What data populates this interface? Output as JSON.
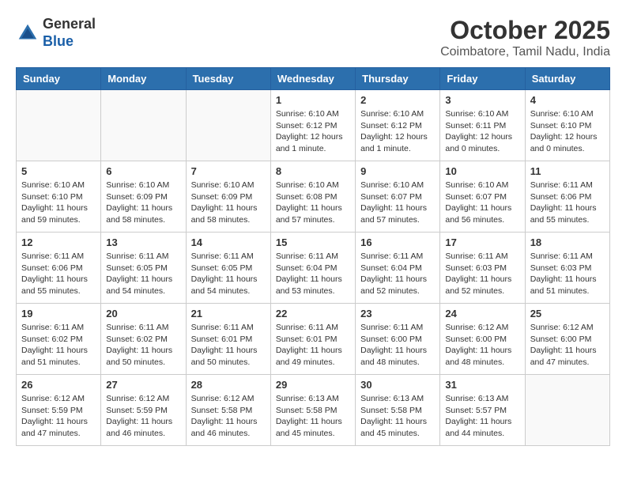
{
  "header": {
    "logo_line1": "General",
    "logo_line2": "Blue",
    "month_title": "October 2025",
    "location": "Coimbatore, Tamil Nadu, India"
  },
  "days_of_week": [
    "Sunday",
    "Monday",
    "Tuesday",
    "Wednesday",
    "Thursday",
    "Friday",
    "Saturday"
  ],
  "weeks": [
    [
      {
        "day": "",
        "info": ""
      },
      {
        "day": "",
        "info": ""
      },
      {
        "day": "",
        "info": ""
      },
      {
        "day": "1",
        "info": "Sunrise: 6:10 AM\nSunset: 6:12 PM\nDaylight: 12 hours\nand 1 minute."
      },
      {
        "day": "2",
        "info": "Sunrise: 6:10 AM\nSunset: 6:12 PM\nDaylight: 12 hours\nand 1 minute."
      },
      {
        "day": "3",
        "info": "Sunrise: 6:10 AM\nSunset: 6:11 PM\nDaylight: 12 hours\nand 0 minutes."
      },
      {
        "day": "4",
        "info": "Sunrise: 6:10 AM\nSunset: 6:10 PM\nDaylight: 12 hours\nand 0 minutes."
      }
    ],
    [
      {
        "day": "5",
        "info": "Sunrise: 6:10 AM\nSunset: 6:10 PM\nDaylight: 11 hours\nand 59 minutes."
      },
      {
        "day": "6",
        "info": "Sunrise: 6:10 AM\nSunset: 6:09 PM\nDaylight: 11 hours\nand 58 minutes."
      },
      {
        "day": "7",
        "info": "Sunrise: 6:10 AM\nSunset: 6:09 PM\nDaylight: 11 hours\nand 58 minutes."
      },
      {
        "day": "8",
        "info": "Sunrise: 6:10 AM\nSunset: 6:08 PM\nDaylight: 11 hours\nand 57 minutes."
      },
      {
        "day": "9",
        "info": "Sunrise: 6:10 AM\nSunset: 6:07 PM\nDaylight: 11 hours\nand 57 minutes."
      },
      {
        "day": "10",
        "info": "Sunrise: 6:10 AM\nSunset: 6:07 PM\nDaylight: 11 hours\nand 56 minutes."
      },
      {
        "day": "11",
        "info": "Sunrise: 6:11 AM\nSunset: 6:06 PM\nDaylight: 11 hours\nand 55 minutes."
      }
    ],
    [
      {
        "day": "12",
        "info": "Sunrise: 6:11 AM\nSunset: 6:06 PM\nDaylight: 11 hours\nand 55 minutes."
      },
      {
        "day": "13",
        "info": "Sunrise: 6:11 AM\nSunset: 6:05 PM\nDaylight: 11 hours\nand 54 minutes."
      },
      {
        "day": "14",
        "info": "Sunrise: 6:11 AM\nSunset: 6:05 PM\nDaylight: 11 hours\nand 54 minutes."
      },
      {
        "day": "15",
        "info": "Sunrise: 6:11 AM\nSunset: 6:04 PM\nDaylight: 11 hours\nand 53 minutes."
      },
      {
        "day": "16",
        "info": "Sunrise: 6:11 AM\nSunset: 6:04 PM\nDaylight: 11 hours\nand 52 minutes."
      },
      {
        "day": "17",
        "info": "Sunrise: 6:11 AM\nSunset: 6:03 PM\nDaylight: 11 hours\nand 52 minutes."
      },
      {
        "day": "18",
        "info": "Sunrise: 6:11 AM\nSunset: 6:03 PM\nDaylight: 11 hours\nand 51 minutes."
      }
    ],
    [
      {
        "day": "19",
        "info": "Sunrise: 6:11 AM\nSunset: 6:02 PM\nDaylight: 11 hours\nand 51 minutes."
      },
      {
        "day": "20",
        "info": "Sunrise: 6:11 AM\nSunset: 6:02 PM\nDaylight: 11 hours\nand 50 minutes."
      },
      {
        "day": "21",
        "info": "Sunrise: 6:11 AM\nSunset: 6:01 PM\nDaylight: 11 hours\nand 50 minutes."
      },
      {
        "day": "22",
        "info": "Sunrise: 6:11 AM\nSunset: 6:01 PM\nDaylight: 11 hours\nand 49 minutes."
      },
      {
        "day": "23",
        "info": "Sunrise: 6:11 AM\nSunset: 6:00 PM\nDaylight: 11 hours\nand 48 minutes."
      },
      {
        "day": "24",
        "info": "Sunrise: 6:12 AM\nSunset: 6:00 PM\nDaylight: 11 hours\nand 48 minutes."
      },
      {
        "day": "25",
        "info": "Sunrise: 6:12 AM\nSunset: 6:00 PM\nDaylight: 11 hours\nand 47 minutes."
      }
    ],
    [
      {
        "day": "26",
        "info": "Sunrise: 6:12 AM\nSunset: 5:59 PM\nDaylight: 11 hours\nand 47 minutes."
      },
      {
        "day": "27",
        "info": "Sunrise: 6:12 AM\nSunset: 5:59 PM\nDaylight: 11 hours\nand 46 minutes."
      },
      {
        "day": "28",
        "info": "Sunrise: 6:12 AM\nSunset: 5:58 PM\nDaylight: 11 hours\nand 46 minutes."
      },
      {
        "day": "29",
        "info": "Sunrise: 6:13 AM\nSunset: 5:58 PM\nDaylight: 11 hours\nand 45 minutes."
      },
      {
        "day": "30",
        "info": "Sunrise: 6:13 AM\nSunset: 5:58 PM\nDaylight: 11 hours\nand 45 minutes."
      },
      {
        "day": "31",
        "info": "Sunrise: 6:13 AM\nSunset: 5:57 PM\nDaylight: 11 hours\nand 44 minutes."
      },
      {
        "day": "",
        "info": ""
      }
    ]
  ]
}
